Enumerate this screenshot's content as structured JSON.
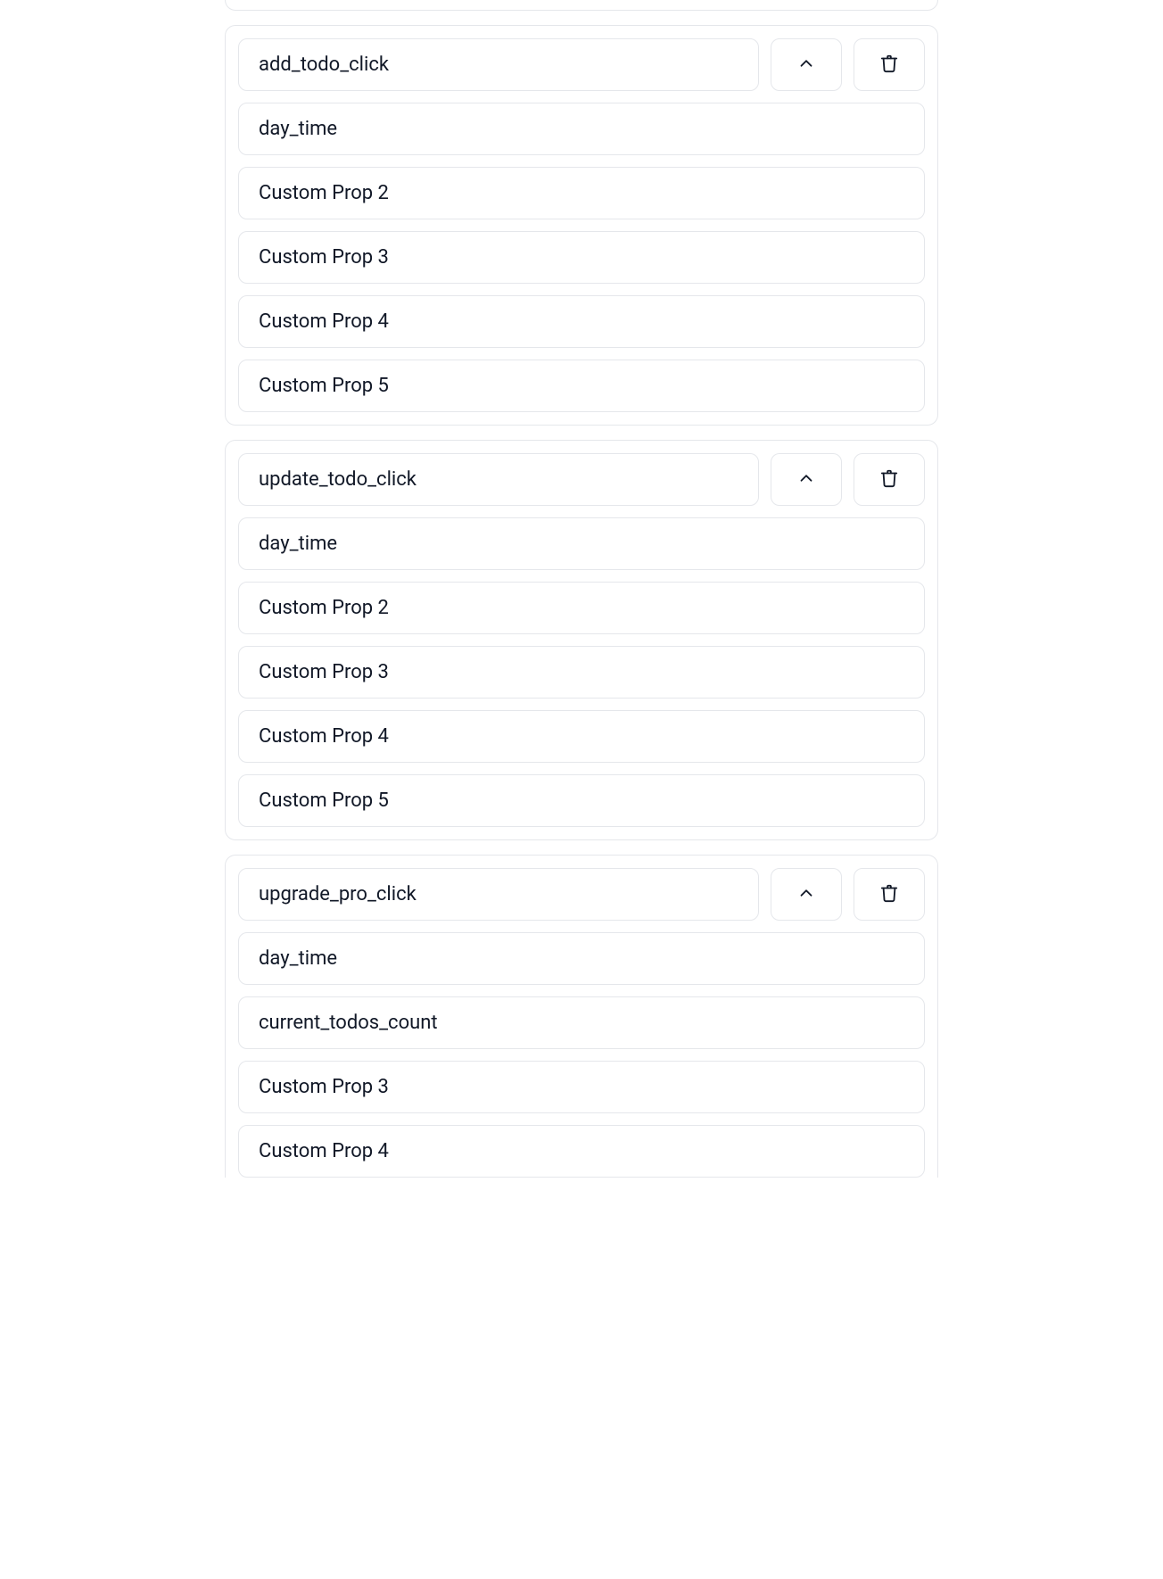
{
  "groups": [
    {
      "event_name": "add_todo_click",
      "props": [
        "day_time",
        "Custom Prop 2",
        "Custom Prop 3",
        "Custom Prop 4",
        "Custom Prop 5"
      ]
    },
    {
      "event_name": "update_todo_click",
      "props": [
        "day_time",
        "Custom Prop 2",
        "Custom Prop 3",
        "Custom Prop 4",
        "Custom Prop 5"
      ]
    },
    {
      "event_name": "upgrade_pro_click",
      "props": [
        "day_time",
        "current_todos_count",
        "Custom Prop 3",
        "Custom Prop 4"
      ]
    }
  ]
}
